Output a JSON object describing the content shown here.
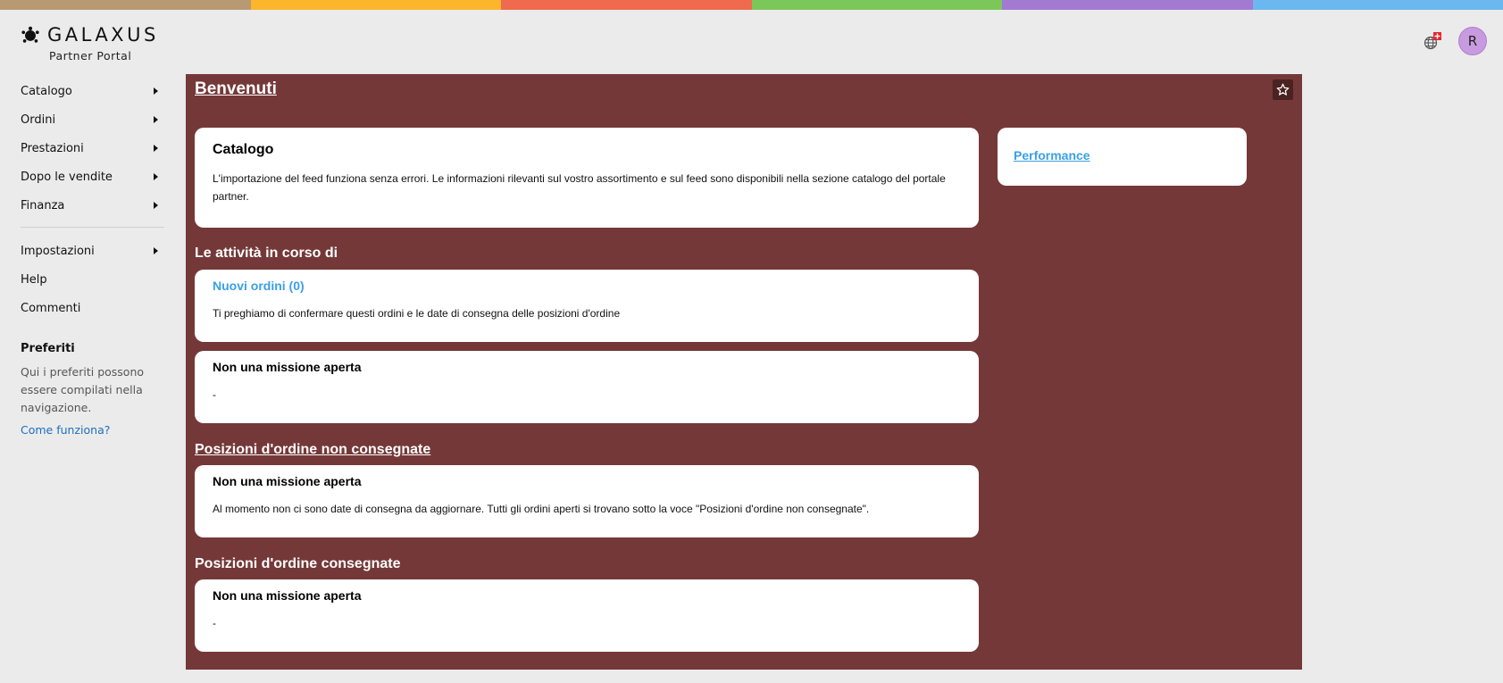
{
  "stripe_colors": [
    "#b89a72",
    "#fbb62c",
    "#f06a4f",
    "#7cc75a",
    "#a37ad1",
    "#6ab8ef"
  ],
  "brand": {
    "name": "GALAXUS",
    "subtitle": "Partner Portal"
  },
  "user": {
    "initial": "R"
  },
  "sidebar": {
    "items": [
      {
        "label": "Catalogo",
        "has_submenu": true
      },
      {
        "label": "Ordini",
        "has_submenu": true
      },
      {
        "label": "Prestazioni",
        "has_submenu": true
      },
      {
        "label": "Dopo le vendite",
        "has_submenu": true
      },
      {
        "label": "Finanza",
        "has_submenu": true
      }
    ],
    "secondary_items": [
      {
        "label": "Impostazioni",
        "has_submenu": true
      },
      {
        "label": "Help",
        "has_submenu": false
      },
      {
        "label": "Commenti",
        "has_submenu": false
      }
    ],
    "favorites": {
      "title": "Preferiti",
      "text": "Qui i preferiti possono essere compilati nella navigazione.",
      "link": "Come funziona?"
    }
  },
  "main": {
    "title": "Benvenuti",
    "catalog_card": {
      "title": "Catalogo",
      "text": "L'importazione del feed funziona senza errori. Le informazioni rilevanti sul vostro assortimento e sul feed sono disponibili nella sezione catalogo del portale partner."
    },
    "activities": {
      "heading": "Le attività in corso di",
      "new_orders": {
        "title": "Nuovi ordini (0)",
        "text": "Ti preghiamo di confermare questi ordini e le date di consegna delle posizioni d'ordine"
      },
      "open_mission": {
        "title": "Non una missione aperta",
        "text": "-"
      }
    },
    "undelivered": {
      "heading": "Posizioni d'ordine non consegnate",
      "card": {
        "title": "Non una missione aperta",
        "text": "Al momento non ci sono date di consegna da aggiornare. Tutti gli ordini aperti si trovano sotto la voce \"Posizioni d'ordine non consegnate\"."
      }
    },
    "delivered": {
      "heading": "Posizioni d'ordine consegnate",
      "card": {
        "title": "Non una missione aperta",
        "text": "-"
      }
    },
    "performance_link": "Performance"
  },
  "colors": {
    "main_bg": "#753838",
    "link": "#3aa0e6",
    "page_bg": "#ebebeb"
  }
}
